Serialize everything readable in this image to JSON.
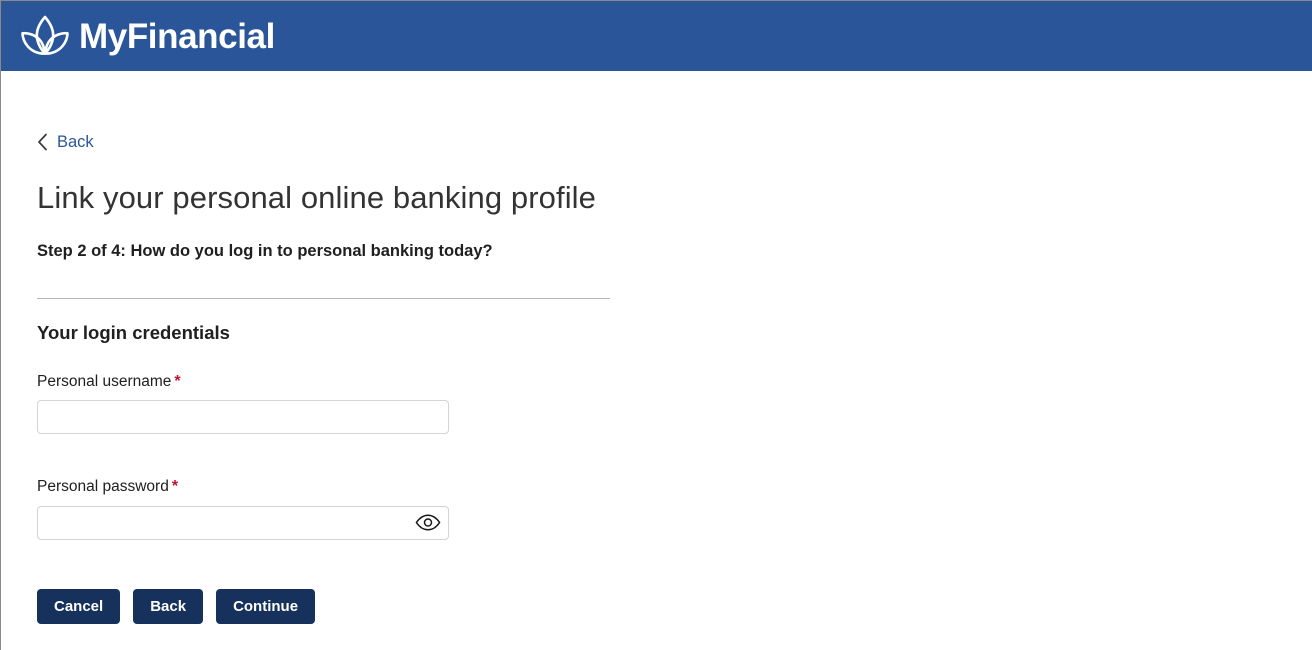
{
  "header": {
    "brand": "MyFinancial",
    "logo_icon": "lotus-flower-icon",
    "background_color": "#2a5699"
  },
  "nav": {
    "back_label": "Back",
    "back_icon": "chevron-left-icon",
    "link_color": "#2a5699"
  },
  "main": {
    "title": "Link your personal online banking profile",
    "step_text": "Step 2 of 4: How do you log in to personal banking today?",
    "section_title": "Your login credentials"
  },
  "form": {
    "required_marker": "*",
    "required_color": "#c8102e",
    "fields": [
      {
        "label": "Personal username",
        "value": "",
        "placeholder": "",
        "required": true,
        "type": "text"
      },
      {
        "label": "Personal password",
        "value": "",
        "placeholder": "",
        "required": true,
        "type": "password",
        "toggle_icon": "eye-icon"
      }
    ]
  },
  "actions": {
    "button_color": "#16325c",
    "buttons": [
      {
        "label": "Cancel"
      },
      {
        "label": "Back"
      },
      {
        "label": "Continue"
      }
    ]
  }
}
